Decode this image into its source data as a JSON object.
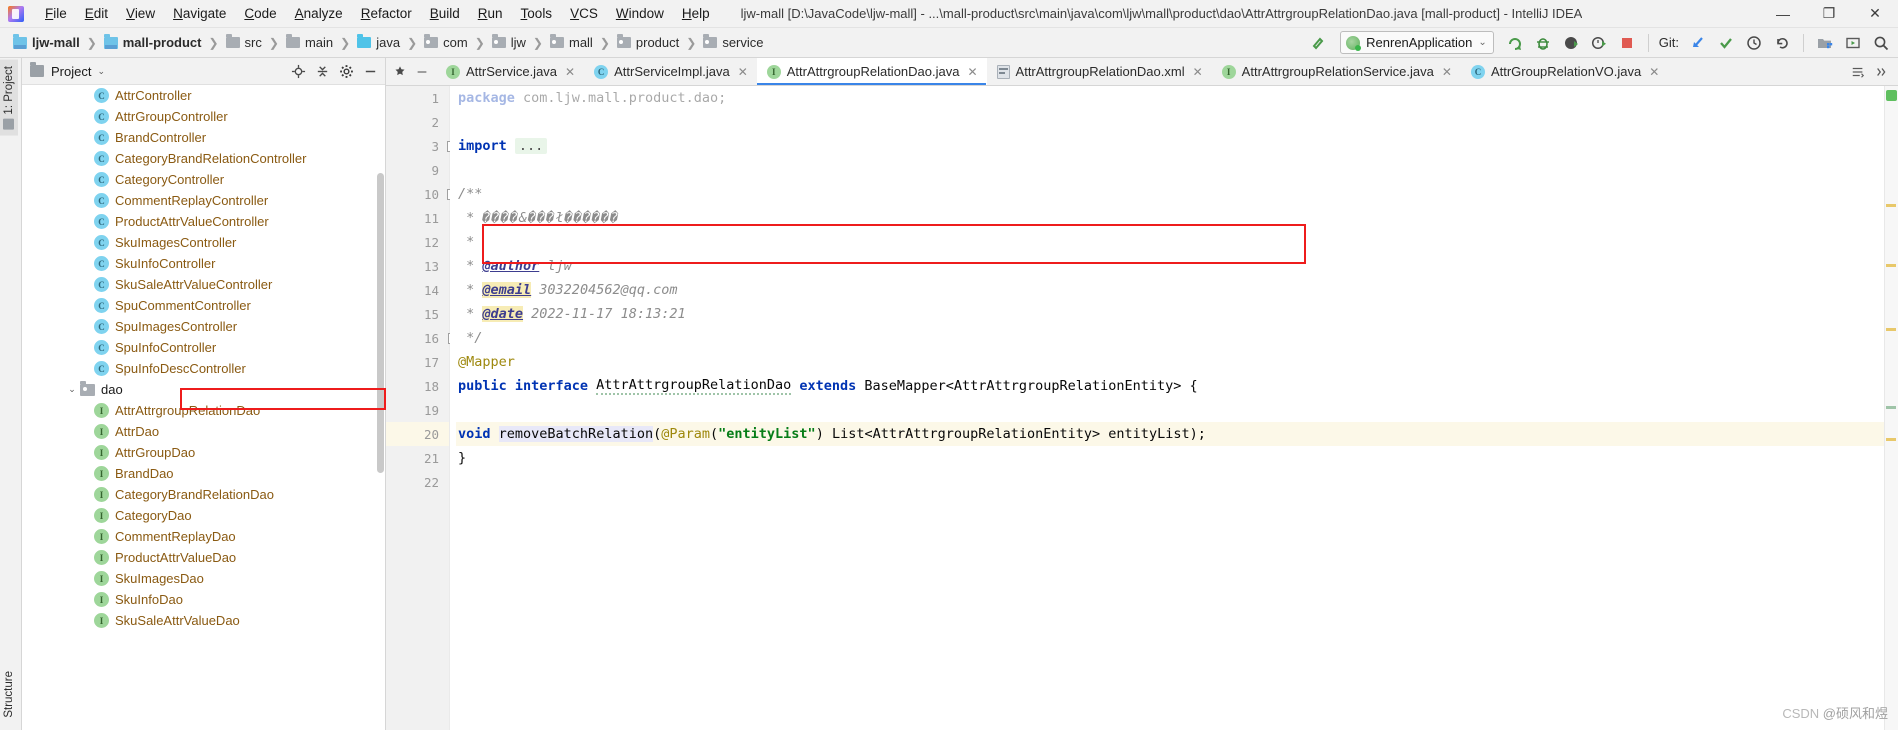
{
  "window": {
    "title": "ljw-mall [D:\\JavaCode\\ljw-mall] - ...\\mall-product\\src\\main\\java\\com\\ljw\\mall\\product\\dao\\AttrAttrgroupRelationDao.java [mall-product] - IntelliJ IDEA",
    "minimize": "—",
    "maximize": "❐",
    "close": "✕"
  },
  "menu": {
    "items": [
      "File",
      "Edit",
      "View",
      "Navigate",
      "Code",
      "Analyze",
      "Refactor",
      "Build",
      "Run",
      "Tools",
      "VCS",
      "Window",
      "Help"
    ]
  },
  "breadcrumb": {
    "items": [
      {
        "label": "ljw-mall",
        "icon": "project-module-icon",
        "bold": true,
        "kind": "module-blue"
      },
      {
        "label": "mall-product",
        "icon": "module-icon",
        "bold": true,
        "kind": "module-blue"
      },
      {
        "label": "src",
        "icon": "folder-icon",
        "bold": false,
        "kind": "folder"
      },
      {
        "label": "main",
        "icon": "folder-icon",
        "bold": false,
        "kind": "folder"
      },
      {
        "label": "java",
        "icon": "source-root-icon",
        "bold": false,
        "kind": "java"
      },
      {
        "label": "com",
        "icon": "package-icon",
        "bold": false,
        "kind": "pkg"
      },
      {
        "label": "ljw",
        "icon": "package-icon",
        "bold": false,
        "kind": "pkg"
      },
      {
        "label": "mall",
        "icon": "package-icon",
        "bold": false,
        "kind": "pkg"
      },
      {
        "label": "product",
        "icon": "package-icon",
        "bold": false,
        "kind": "pkg"
      },
      {
        "label": "service",
        "icon": "package-icon",
        "bold": false,
        "kind": "pkg"
      }
    ],
    "separator": "❯"
  },
  "toolbar": {
    "build_icon": "hammer-icon",
    "run_config": {
      "name": "RenrenApplication",
      "icon": "spring-boot-icon",
      "caret": "⌄"
    },
    "actions": [
      {
        "name": "run-button",
        "glyph": "➤"
      },
      {
        "name": "debug-button",
        "glyph": "🐞"
      },
      {
        "name": "run-coverage-button",
        "glyph": "▶"
      },
      {
        "name": "profiler-button",
        "glyph": "⏱"
      },
      {
        "name": "stop-button",
        "glyph": "■"
      }
    ],
    "git_label": "Git:",
    "git_actions": [
      {
        "name": "update-project-button",
        "glyph": "↙"
      },
      {
        "name": "commit-button",
        "glyph": "✔"
      },
      {
        "name": "history-button",
        "glyph": "◴"
      },
      {
        "name": "rollback-button",
        "glyph": "↶"
      }
    ],
    "right_actions": [
      {
        "name": "project-structure-button",
        "glyph": "▤"
      },
      {
        "name": "select-in-button",
        "glyph": "▷"
      },
      {
        "name": "search-everywhere-button",
        "glyph": "⚲"
      }
    ]
  },
  "left_strip": {
    "tabs": [
      {
        "label": "1: Project",
        "name": "tool-window-project"
      },
      {
        "label": "Structure",
        "name": "tool-window-structure"
      }
    ]
  },
  "project_panel": {
    "title": "Project",
    "view_caret": "⌄",
    "actions": [
      {
        "name": "scroll-from-source-icon",
        "glyph": "⊕"
      },
      {
        "name": "collapse-all-icon",
        "glyph": "⇵"
      },
      {
        "name": "settings-gear-icon",
        "glyph": "⚙"
      },
      {
        "name": "hide-panel-icon",
        "glyph": "—"
      }
    ],
    "tree": [
      {
        "label": "AttrController",
        "kind": "class",
        "indent": 4,
        "partial": true
      },
      {
        "label": "AttrGroupController",
        "kind": "class",
        "indent": 4
      },
      {
        "label": "BrandController",
        "kind": "class",
        "indent": 4
      },
      {
        "label": "CategoryBrandRelationController",
        "kind": "class",
        "indent": 4
      },
      {
        "label": "CategoryController",
        "kind": "class",
        "indent": 4
      },
      {
        "label": "CommentReplayController",
        "kind": "class",
        "indent": 4
      },
      {
        "label": "ProductAttrValueController",
        "kind": "class",
        "indent": 4
      },
      {
        "label": "SkuImagesController",
        "kind": "class",
        "indent": 4
      },
      {
        "label": "SkuInfoController",
        "kind": "class",
        "indent": 4
      },
      {
        "label": "SkuSaleAttrValueController",
        "kind": "class",
        "indent": 4
      },
      {
        "label": "SpuCommentController",
        "kind": "class",
        "indent": 4
      },
      {
        "label": "SpuImagesController",
        "kind": "class",
        "indent": 4
      },
      {
        "label": "SpuInfoController",
        "kind": "class",
        "indent": 4
      },
      {
        "label": "SpuInfoDescController",
        "kind": "class",
        "indent": 4
      },
      {
        "label": "dao",
        "kind": "package",
        "indent": 3,
        "expanded": true
      },
      {
        "label": "AttrAttrgroupRelationDao",
        "kind": "interface",
        "indent": 4,
        "highlighted": true
      },
      {
        "label": "AttrDao",
        "kind": "interface",
        "indent": 4
      },
      {
        "label": "AttrGroupDao",
        "kind": "interface",
        "indent": 4
      },
      {
        "label": "BrandDao",
        "kind": "interface",
        "indent": 4
      },
      {
        "label": "CategoryBrandRelationDao",
        "kind": "interface",
        "indent": 4
      },
      {
        "label": "CategoryDao",
        "kind": "interface",
        "indent": 4
      },
      {
        "label": "CommentReplayDao",
        "kind": "interface",
        "indent": 4
      },
      {
        "label": "ProductAttrValueDao",
        "kind": "interface",
        "indent": 4
      },
      {
        "label": "SkuImagesDao",
        "kind": "interface",
        "indent": 4
      },
      {
        "label": "SkuInfoDao",
        "kind": "interface",
        "indent": 4
      },
      {
        "label": "SkuSaleAttrValueDao",
        "kind": "interface",
        "indent": 4,
        "partial": true
      }
    ]
  },
  "editor": {
    "tabs": [
      {
        "label": "AttrService.java",
        "kind": "interface",
        "active": false,
        "close": "✕"
      },
      {
        "label": "AttrServiceImpl.java",
        "kind": "class",
        "active": false,
        "close": "✕"
      },
      {
        "label": "AttrAttrgroupRelationDao.java",
        "kind": "interface",
        "active": true,
        "close": "✕"
      },
      {
        "label": "AttrAttrgroupRelationDao.xml",
        "kind": "xml",
        "active": false,
        "close": "✕"
      },
      {
        "label": "AttrAttrgroupRelationService.java",
        "kind": "interface",
        "active": false,
        "close": "✕"
      },
      {
        "label": "AttrGroupRelationVO.java",
        "kind": "class",
        "active": false,
        "close": "✕"
      }
    ],
    "tab_left_actions": [
      {
        "name": "pin-tab-icon",
        "glyph": "✷"
      },
      {
        "name": "hide-tabs-icon",
        "glyph": "—"
      }
    ],
    "tab_right_actions": [
      {
        "name": "tab-list-icon",
        "glyph": "≡"
      },
      {
        "name": "tab-overflow-icon",
        "glyph": "»"
      }
    ],
    "lines": [
      {
        "num": "1",
        "clipped": true,
        "tokens": [
          {
            "t": "package ",
            "c": "kw"
          },
          {
            "t": "com.ljw.mall.product.dao;",
            "c": "plain"
          }
        ]
      },
      {
        "num": "2",
        "tokens": []
      },
      {
        "num": "3",
        "fold": "plus",
        "tokens": [
          {
            "t": "import ",
            "c": "kw"
          },
          {
            "t": "...",
            "c": "foldinline"
          }
        ]
      },
      {
        "num": "9",
        "tokens": []
      },
      {
        "num": "10",
        "fold": "open",
        "tokens": [
          {
            "t": "/**",
            "c": "cm"
          }
        ]
      },
      {
        "num": "11",
        "tokens": [
          {
            "t": " * ",
            "c": "cm"
          },
          {
            "t": "����&���ł������",
            "c": "mojibake"
          }
        ]
      },
      {
        "num": "12",
        "tokens": [
          {
            "t": " *",
            "c": "cm"
          }
        ]
      },
      {
        "num": "13",
        "tokens": [
          {
            "t": " * ",
            "c": "cm"
          },
          {
            "t": "@author",
            "c": "cmtag"
          },
          {
            "t": " ljw",
            "c": "cm"
          }
        ]
      },
      {
        "num": "14",
        "tokens": [
          {
            "t": " * ",
            "c": "cm"
          },
          {
            "t": "@email",
            "c": "cmtag-hl"
          },
          {
            "t": " 3032204562@qq.com",
            "c": "cm"
          }
        ]
      },
      {
        "num": "15",
        "tokens": [
          {
            "t": " * ",
            "c": "cm"
          },
          {
            "t": "@date",
            "c": "cmtag-hl"
          },
          {
            "t": " 2022-11-17 18:13:21",
            "c": "cm"
          }
        ]
      },
      {
        "num": "16",
        "fold": "close",
        "tokens": [
          {
            "t": " */",
            "c": "cm"
          }
        ]
      },
      {
        "num": "17",
        "tokens": [
          {
            "t": "@Mapper",
            "c": "ann"
          }
        ]
      },
      {
        "num": "18",
        "tokens": [
          {
            "t": "public interface ",
            "c": "kw"
          },
          {
            "t": "AttrAttrgroupRelationDao",
            "c": "squiggle"
          },
          {
            "t": " ",
            "c": "plain"
          },
          {
            "t": "extends",
            "c": "kw"
          },
          {
            "t": " BaseMapper<AttrAttrgroupRelationEntity> {",
            "c": "plain"
          }
        ]
      },
      {
        "num": "19",
        "tokens": []
      },
      {
        "num": "20",
        "highlighted": true,
        "bulb": true,
        "tokens": [
          {
            "t": "void",
            "c": "kw"
          },
          {
            "t": " ",
            "c": "plain"
          },
          {
            "t": "removeBatchRelation",
            "c": "mth"
          },
          {
            "t": "(",
            "c": "plain"
          },
          {
            "t": "@Param",
            "c": "ann"
          },
          {
            "t": "(",
            "c": "plain"
          },
          {
            "t": "\"entityList\"",
            "c": "str"
          },
          {
            "t": ") List<AttrAttrgroupRelationEntity> entityList);",
            "c": "plain"
          }
        ]
      },
      {
        "num": "21",
        "tokens": [
          {
            "t": "}",
            "c": "plain"
          }
        ]
      },
      {
        "num": "22",
        "tokens": []
      }
    ],
    "inspection_status": "ok-green"
  },
  "watermark": {
    "prefix": "CSDN ",
    "author": "@硕风和煜"
  }
}
